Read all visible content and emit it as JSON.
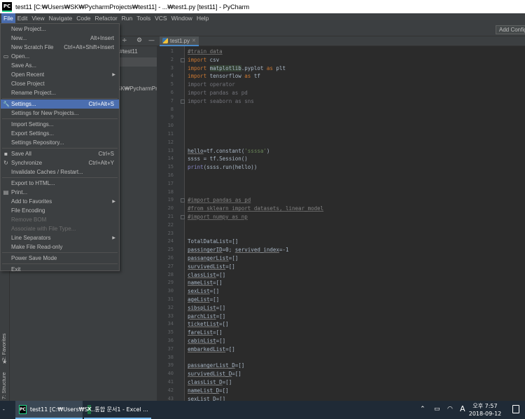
{
  "window": {
    "title": "test11 [C:₩Users₩SK₩PycharmProjects₩test11] - ...₩test1.py [test11] - PyCharm",
    "logo": "PC"
  },
  "menubar": [
    "File",
    "Edit",
    "View",
    "Navigate",
    "Code",
    "Refactor",
    "Run",
    "Tools",
    "VCS",
    "Window",
    "Help"
  ],
  "toolbar": {
    "add_config": "Add Configuration..."
  },
  "project": {
    "folder": "#test11",
    "path": "SK₩PycharmProj"
  },
  "sidebar": {
    "favorites": "2: Favorites",
    "structure": "7: Structure"
  },
  "editor": {
    "tab": "test1.py",
    "lines": [
      {
        "n": "1",
        "t": [
          [
            "comment",
            "#train data"
          ]
        ]
      },
      {
        "n": "2",
        "t": [
          [
            "kw",
            "import"
          ],
          [
            "text",
            " csv"
          ]
        ]
      },
      {
        "n": "3",
        "t": [
          [
            "kw",
            "import"
          ],
          [
            "text",
            " "
          ],
          [
            "hl",
            "matplotlib"
          ],
          [
            "text",
            ".pyplot "
          ],
          [
            "kw",
            "as"
          ],
          [
            "text",
            " plt"
          ]
        ]
      },
      {
        "n": "4",
        "t": [
          [
            "kw",
            "import"
          ],
          [
            "text",
            " tensorflow "
          ],
          [
            "kw",
            "as"
          ],
          [
            "text",
            " tf"
          ]
        ]
      },
      {
        "n": "5",
        "t": [
          [
            "dim",
            "import operator"
          ]
        ]
      },
      {
        "n": "6",
        "t": [
          [
            "dim",
            "import pandas as pd"
          ]
        ]
      },
      {
        "n": "7",
        "t": [
          [
            "dim",
            "import seaborn as sns"
          ]
        ]
      },
      {
        "n": "8",
        "t": []
      },
      {
        "n": "9",
        "t": []
      },
      {
        "n": "10",
        "t": []
      },
      {
        "n": "11",
        "t": []
      },
      {
        "n": "12",
        "t": []
      },
      {
        "n": "13",
        "t": [
          [
            "ul",
            "hello"
          ],
          [
            "text",
            "=tf.constant("
          ],
          [
            "str",
            "'ssssa'"
          ],
          [
            "text",
            ")"
          ]
        ]
      },
      {
        "n": "14",
        "t": [
          [
            "text",
            "ssss = tf.Session()"
          ]
        ]
      },
      {
        "n": "15",
        "t": [
          [
            "fn",
            "print"
          ],
          [
            "text",
            "(ssss.run(hello))"
          ]
        ]
      },
      {
        "n": "16",
        "t": []
      },
      {
        "n": "17",
        "t": []
      },
      {
        "n": "18",
        "t": []
      },
      {
        "n": "19",
        "t": [
          [
            "comment",
            "#import pandas as pd"
          ]
        ]
      },
      {
        "n": "20",
        "t": [
          [
            "comment",
            "#from sklearn import datasets, linear_model"
          ]
        ]
      },
      {
        "n": "21",
        "t": [
          [
            "comment",
            "#import numpy as np"
          ]
        ]
      },
      {
        "n": "22",
        "t": []
      },
      {
        "n": "23",
        "t": []
      },
      {
        "n": "24",
        "t": [
          [
            "text",
            "TotalDataList=[]"
          ]
        ]
      },
      {
        "n": "25",
        "t": [
          [
            "ul",
            "passingerID"
          ],
          [
            "text",
            "=0; "
          ],
          [
            "ul",
            "servived_index"
          ],
          [
            "text",
            "=-1"
          ]
        ]
      },
      {
        "n": "26",
        "t": [
          [
            "ul",
            "passangerList"
          ],
          [
            "text",
            "=[]"
          ]
        ]
      },
      {
        "n": "27",
        "t": [
          [
            "ul",
            "survivedList"
          ],
          [
            "text",
            "=[]"
          ]
        ]
      },
      {
        "n": "28",
        "t": [
          [
            "ul",
            "classList"
          ],
          [
            "text",
            "=[]"
          ]
        ]
      },
      {
        "n": "29",
        "t": [
          [
            "ul",
            "nameList"
          ],
          [
            "text",
            "=[]"
          ]
        ]
      },
      {
        "n": "30",
        "t": [
          [
            "ul",
            "sexList"
          ],
          [
            "text",
            "=[]"
          ]
        ]
      },
      {
        "n": "31",
        "t": [
          [
            "ul",
            "ageList"
          ],
          [
            "text",
            "=[]"
          ]
        ]
      },
      {
        "n": "32",
        "t": [
          [
            "ul",
            "sibspList"
          ],
          [
            "text",
            "=[]"
          ]
        ]
      },
      {
        "n": "33",
        "t": [
          [
            "ul",
            "parchList"
          ],
          [
            "text",
            "=[]"
          ]
        ]
      },
      {
        "n": "34",
        "t": [
          [
            "ul",
            "ticketList"
          ],
          [
            "text",
            "=[]"
          ]
        ]
      },
      {
        "n": "35",
        "t": [
          [
            "ul",
            "fareList"
          ],
          [
            "text",
            "=[]"
          ]
        ]
      },
      {
        "n": "36",
        "t": [
          [
            "ul",
            "cabinList"
          ],
          [
            "text",
            "=[]"
          ]
        ]
      },
      {
        "n": "37",
        "t": [
          [
            "ul",
            "embarkedList"
          ],
          [
            "text",
            "=[]"
          ]
        ]
      },
      {
        "n": "38",
        "t": []
      },
      {
        "n": "39",
        "t": [
          [
            "ul",
            "passangerList_D"
          ],
          [
            "text",
            "=[]"
          ]
        ]
      },
      {
        "n": "40",
        "t": [
          [
            "ul",
            "survivedList_D"
          ],
          [
            "text",
            "=[]"
          ]
        ]
      },
      {
        "n": "41",
        "t": [
          [
            "ul",
            "classList_D"
          ],
          [
            "text",
            "=[]"
          ]
        ]
      },
      {
        "n": "42",
        "t": [
          [
            "ul",
            "nameList_D"
          ],
          [
            "text",
            "=[]"
          ]
        ]
      },
      {
        "n": "43",
        "t": [
          [
            "ul",
            "sexList_D"
          ],
          [
            "text",
            "=[]"
          ]
        ]
      }
    ]
  },
  "file_menu": [
    {
      "label": "New Project...",
      "shortcut": ""
    },
    {
      "label": "New...",
      "shortcut": "Alt+Insert"
    },
    {
      "label": "New Scratch File",
      "shortcut": "Ctrl+Alt+Shift+Insert"
    },
    {
      "label": "Open...",
      "shortcut": "",
      "icon": "open-folder-icon"
    },
    {
      "label": "Save As...",
      "shortcut": ""
    },
    {
      "label": "Open Recent",
      "shortcut": "",
      "submenu": true
    },
    {
      "label": "Close Project",
      "shortcut": ""
    },
    {
      "label": "Rename Project...",
      "shortcut": ""
    },
    {
      "sep": true
    },
    {
      "label": "Settings...",
      "shortcut": "Ctrl+Alt+S",
      "icon": "wrench-icon",
      "highlighted": true
    },
    {
      "label": "Settings for New Projects...",
      "shortcut": ""
    },
    {
      "sep": true
    },
    {
      "label": "Import Settings...",
      "shortcut": ""
    },
    {
      "label": "Export Settings...",
      "shortcut": ""
    },
    {
      "label": "Settings Repository...",
      "shortcut": ""
    },
    {
      "sep": true
    },
    {
      "label": "Save All",
      "shortcut": "Ctrl+S",
      "icon": "save-icon"
    },
    {
      "label": "Synchronize",
      "shortcut": "Ctrl+Alt+Y",
      "icon": "sync-icon"
    },
    {
      "label": "Invalidate Caches / Restart...",
      "shortcut": ""
    },
    {
      "sep": true
    },
    {
      "label": "Export to HTML...",
      "shortcut": ""
    },
    {
      "label": "Print...",
      "shortcut": "",
      "icon": "print-icon"
    },
    {
      "label": "Add to Favorites",
      "shortcut": "",
      "submenu": true
    },
    {
      "label": "File Encoding",
      "shortcut": ""
    },
    {
      "label": "Remove BOM",
      "shortcut": "",
      "disabled": true
    },
    {
      "label": "Associate with File Type...",
      "shortcut": "",
      "disabled": true
    },
    {
      "label": "Line Separators",
      "shortcut": "",
      "submenu": true
    },
    {
      "label": "Make File Read-only",
      "shortcut": ""
    },
    {
      "sep": true
    },
    {
      "label": "Power Save Mode",
      "shortcut": ""
    },
    {
      "sep": true
    },
    {
      "label": "Exit",
      "shortcut": ""
    }
  ],
  "taskbar": {
    "start": "-",
    "apps": [
      {
        "label": "test11 [C:₩Users₩SK...",
        "icon": "pycharm-icon",
        "active": true
      },
      {
        "label": "통합 문서1 - Excel ...",
        "icon": "excel-icon",
        "active": false
      }
    ],
    "ime": "A",
    "time": "오후 7:57",
    "date": "2018-09-12"
  }
}
